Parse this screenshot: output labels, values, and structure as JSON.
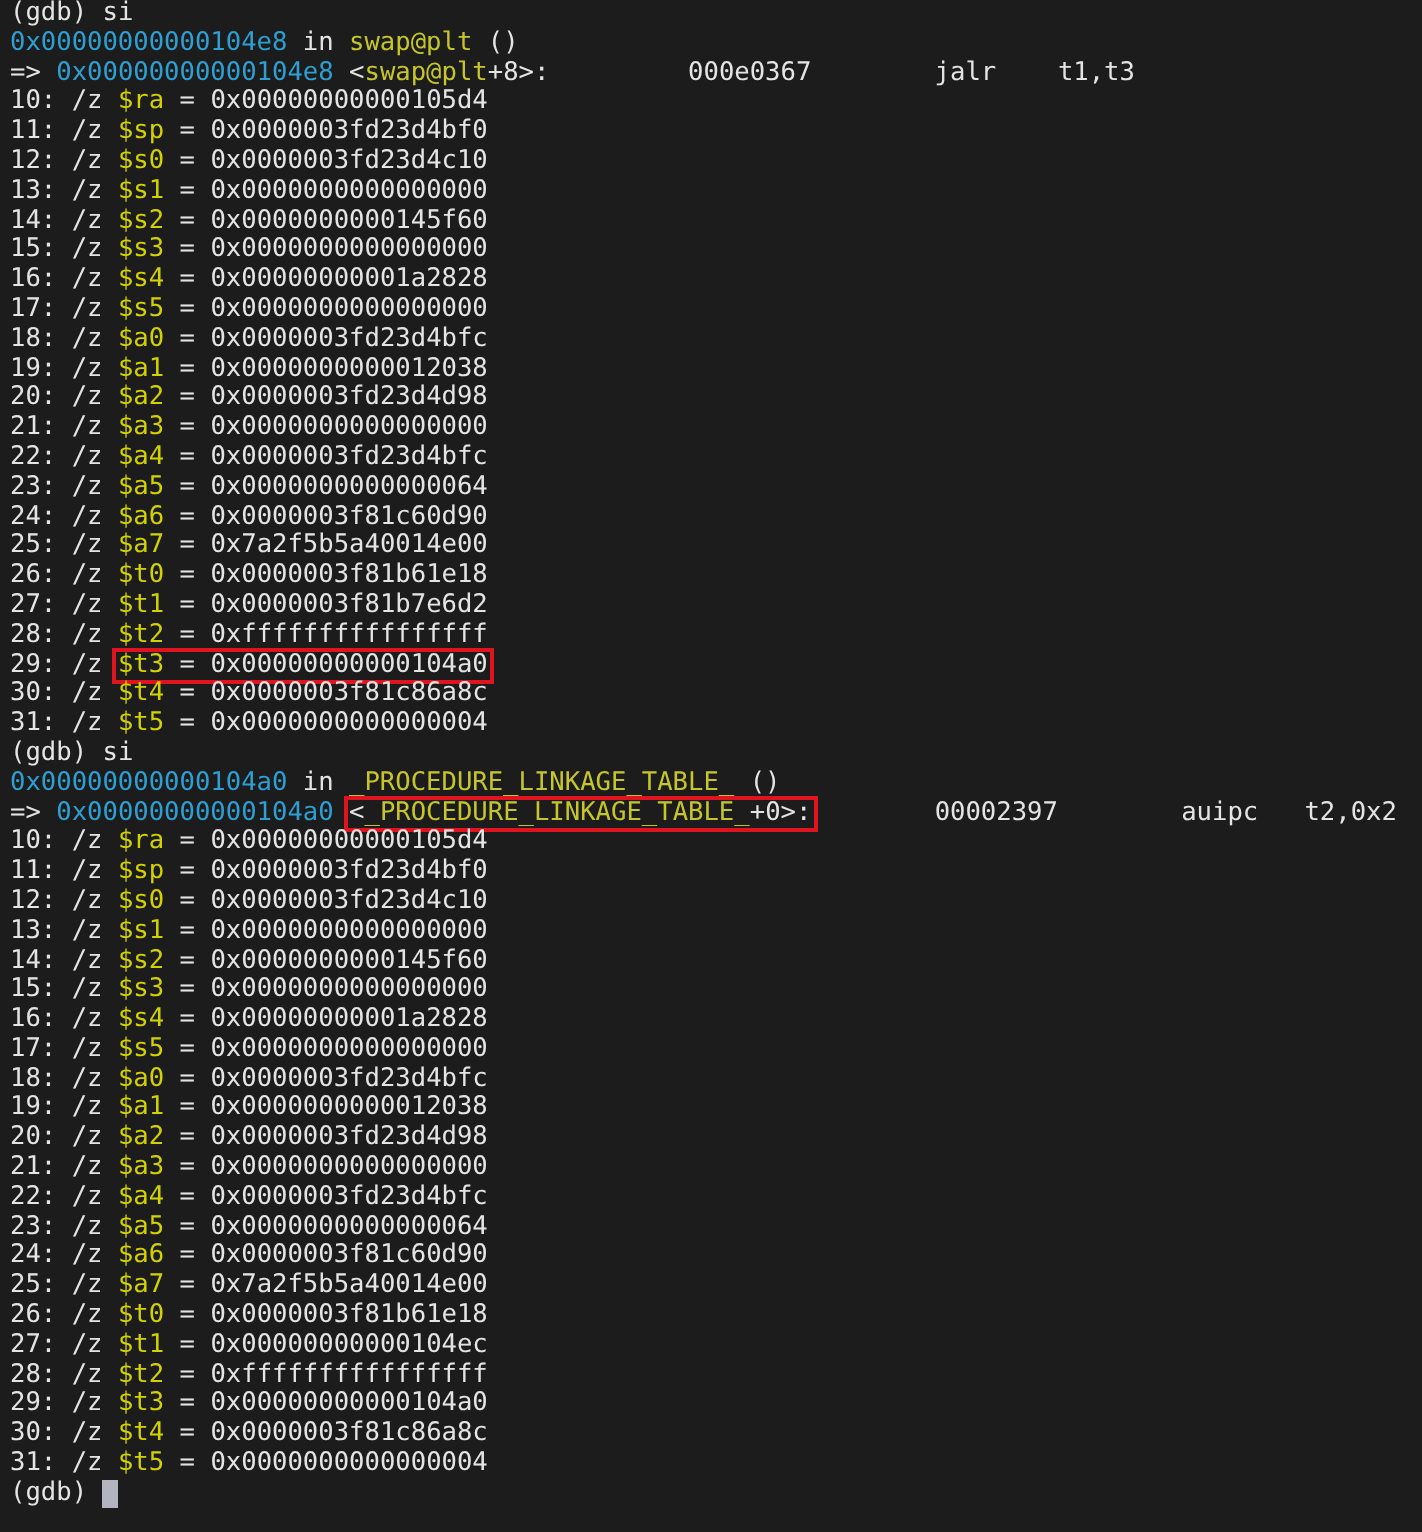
{
  "lines": [
    {
      "kind": "prompt",
      "prompt": "(gdb)",
      "command": "si",
      "cursor": false
    },
    {
      "kind": "location",
      "address": "0x00000000000104e8",
      "in": "in",
      "function": "swap@plt",
      "args": "()"
    },
    {
      "kind": "instruction",
      "arrow": "=>",
      "address": "0x00000000000104e8",
      "symbol_open": "<",
      "symbol": "swap@plt",
      "symbol_close": "+8>:",
      "encoding": "000e0367",
      "mnemonic": "jalr",
      "operands": "t1,t3",
      "boxed": false
    },
    {
      "kind": "register",
      "index": "10:",
      "format": "/z",
      "name": "$ra",
      "equals": "=",
      "value": "0x00000000000105d4",
      "boxed": false
    },
    {
      "kind": "register",
      "index": "11:",
      "format": "/z",
      "name": "$sp",
      "equals": "=",
      "value": "0x0000003fd23d4bf0",
      "boxed": false
    },
    {
      "kind": "register",
      "index": "12:",
      "format": "/z",
      "name": "$s0",
      "equals": "=",
      "value": "0x0000003fd23d4c10",
      "boxed": false
    },
    {
      "kind": "register",
      "index": "13:",
      "format": "/z",
      "name": "$s1",
      "equals": "=",
      "value": "0x0000000000000000",
      "boxed": false
    },
    {
      "kind": "register",
      "index": "14:",
      "format": "/z",
      "name": "$s2",
      "equals": "=",
      "value": "0x0000000000145f60",
      "boxed": false
    },
    {
      "kind": "register",
      "index": "15:",
      "format": "/z",
      "name": "$s3",
      "equals": "=",
      "value": "0x0000000000000000",
      "boxed": false
    },
    {
      "kind": "register",
      "index": "16:",
      "format": "/z",
      "name": "$s4",
      "equals": "=",
      "value": "0x00000000001a2828",
      "boxed": false
    },
    {
      "kind": "register",
      "index": "17:",
      "format": "/z",
      "name": "$s5",
      "equals": "=",
      "value": "0x0000000000000000",
      "boxed": false
    },
    {
      "kind": "register",
      "index": "18:",
      "format": "/z",
      "name": "$a0",
      "equals": "=",
      "value": "0x0000003fd23d4bfc",
      "boxed": false
    },
    {
      "kind": "register",
      "index": "19:",
      "format": "/z",
      "name": "$a1",
      "equals": "=",
      "value": "0x0000000000012038",
      "boxed": false
    },
    {
      "kind": "register",
      "index": "20:",
      "format": "/z",
      "name": "$a2",
      "equals": "=",
      "value": "0x0000003fd23d4d98",
      "boxed": false
    },
    {
      "kind": "register",
      "index": "21:",
      "format": "/z",
      "name": "$a3",
      "equals": "=",
      "value": "0x0000000000000000",
      "boxed": false
    },
    {
      "kind": "register",
      "index": "22:",
      "format": "/z",
      "name": "$a4",
      "equals": "=",
      "value": "0x0000003fd23d4bfc",
      "boxed": false
    },
    {
      "kind": "register",
      "index": "23:",
      "format": "/z",
      "name": "$a5",
      "equals": "=",
      "value": "0x0000000000000064",
      "boxed": false
    },
    {
      "kind": "register",
      "index": "24:",
      "format": "/z",
      "name": "$a6",
      "equals": "=",
      "value": "0x0000003f81c60d90",
      "boxed": false
    },
    {
      "kind": "register",
      "index": "25:",
      "format": "/z",
      "name": "$a7",
      "equals": "=",
      "value": "0x7a2f5b5a40014e00",
      "boxed": false
    },
    {
      "kind": "register",
      "index": "26:",
      "format": "/z",
      "name": "$t0",
      "equals": "=",
      "value": "0x0000003f81b61e18",
      "boxed": false
    },
    {
      "kind": "register",
      "index": "27:",
      "format": "/z",
      "name": "$t1",
      "equals": "=",
      "value": "0x0000003f81b7e6d2",
      "boxed": false
    },
    {
      "kind": "register",
      "index": "28:",
      "format": "/z",
      "name": "$t2",
      "equals": "=",
      "value": "0xffffffffffffffff",
      "boxed": false
    },
    {
      "kind": "register",
      "index": "29:",
      "format": "/z",
      "name": "$t3",
      "equals": "=",
      "value": "0x00000000000104a0",
      "boxed": true
    },
    {
      "kind": "register",
      "index": "30:",
      "format": "/z",
      "name": "$t4",
      "equals": "=",
      "value": "0x0000003f81c86a8c",
      "boxed": false
    },
    {
      "kind": "register",
      "index": "31:",
      "format": "/z",
      "name": "$t5",
      "equals": "=",
      "value": "0x0000000000000004",
      "boxed": false
    },
    {
      "kind": "prompt",
      "prompt": "(gdb)",
      "command": "si",
      "cursor": false
    },
    {
      "kind": "location",
      "address": "0x00000000000104a0",
      "in": "in",
      "function": "_PROCEDURE_LINKAGE_TABLE_",
      "args": "()"
    },
    {
      "kind": "instruction",
      "arrow": "=>",
      "address": "0x00000000000104a0",
      "symbol_open": "<",
      "symbol": "_PROCEDURE_LINKAGE_TABLE_",
      "symbol_close": "+0>:",
      "encoding": "00002397",
      "mnemonic": "auipc",
      "operands": "t2,0x2",
      "boxed": true
    },
    {
      "kind": "register",
      "index": "10:",
      "format": "/z",
      "name": "$ra",
      "equals": "=",
      "value": "0x00000000000105d4",
      "boxed": false
    },
    {
      "kind": "register",
      "index": "11:",
      "format": "/z",
      "name": "$sp",
      "equals": "=",
      "value": "0x0000003fd23d4bf0",
      "boxed": false
    },
    {
      "kind": "register",
      "index": "12:",
      "format": "/z",
      "name": "$s0",
      "equals": "=",
      "value": "0x0000003fd23d4c10",
      "boxed": false
    },
    {
      "kind": "register",
      "index": "13:",
      "format": "/z",
      "name": "$s1",
      "equals": "=",
      "value": "0x0000000000000000",
      "boxed": false
    },
    {
      "kind": "register",
      "index": "14:",
      "format": "/z",
      "name": "$s2",
      "equals": "=",
      "value": "0x0000000000145f60",
      "boxed": false
    },
    {
      "kind": "register",
      "index": "15:",
      "format": "/z",
      "name": "$s3",
      "equals": "=",
      "value": "0x0000000000000000",
      "boxed": false
    },
    {
      "kind": "register",
      "index": "16:",
      "format": "/z",
      "name": "$s4",
      "equals": "=",
      "value": "0x00000000001a2828",
      "boxed": false
    },
    {
      "kind": "register",
      "index": "17:",
      "format": "/z",
      "name": "$s5",
      "equals": "=",
      "value": "0x0000000000000000",
      "boxed": false
    },
    {
      "kind": "register",
      "index": "18:",
      "format": "/z",
      "name": "$a0",
      "equals": "=",
      "value": "0x0000003fd23d4bfc",
      "boxed": false
    },
    {
      "kind": "register",
      "index": "19:",
      "format": "/z",
      "name": "$a1",
      "equals": "=",
      "value": "0x0000000000012038",
      "boxed": false
    },
    {
      "kind": "register",
      "index": "20:",
      "format": "/z",
      "name": "$a2",
      "equals": "=",
      "value": "0x0000003fd23d4d98",
      "boxed": false
    },
    {
      "kind": "register",
      "index": "21:",
      "format": "/z",
      "name": "$a3",
      "equals": "=",
      "value": "0x0000000000000000",
      "boxed": false
    },
    {
      "kind": "register",
      "index": "22:",
      "format": "/z",
      "name": "$a4",
      "equals": "=",
      "value": "0x0000003fd23d4bfc",
      "boxed": false
    },
    {
      "kind": "register",
      "index": "23:",
      "format": "/z",
      "name": "$a5",
      "equals": "=",
      "value": "0x0000000000000064",
      "boxed": false
    },
    {
      "kind": "register",
      "index": "24:",
      "format": "/z",
      "name": "$a6",
      "equals": "=",
      "value": "0x0000003f81c60d90",
      "boxed": false
    },
    {
      "kind": "register",
      "index": "25:",
      "format": "/z",
      "name": "$a7",
      "equals": "=",
      "value": "0x7a2f5b5a40014e00",
      "boxed": false
    },
    {
      "kind": "register",
      "index": "26:",
      "format": "/z",
      "name": "$t0",
      "equals": "=",
      "value": "0x0000003f81b61e18",
      "boxed": false
    },
    {
      "kind": "register",
      "index": "27:",
      "format": "/z",
      "name": "$t1",
      "equals": "=",
      "value": "0x00000000000104ec",
      "boxed": false
    },
    {
      "kind": "register",
      "index": "28:",
      "format": "/z",
      "name": "$t2",
      "equals": "=",
      "value": "0xffffffffffffffff",
      "boxed": false
    },
    {
      "kind": "register",
      "index": "29:",
      "format": "/z",
      "name": "$t3",
      "equals": "=",
      "value": "0x00000000000104a0",
      "boxed": false
    },
    {
      "kind": "register",
      "index": "30:",
      "format": "/z",
      "name": "$t4",
      "equals": "=",
      "value": "0x0000003f81c86a8c",
      "boxed": false
    },
    {
      "kind": "register",
      "index": "31:",
      "format": "/z",
      "name": "$t5",
      "equals": "=",
      "value": "0x0000000000000004",
      "boxed": false
    },
    {
      "kind": "prompt",
      "prompt": "(gdb)",
      "cursor": true
    }
  ]
}
